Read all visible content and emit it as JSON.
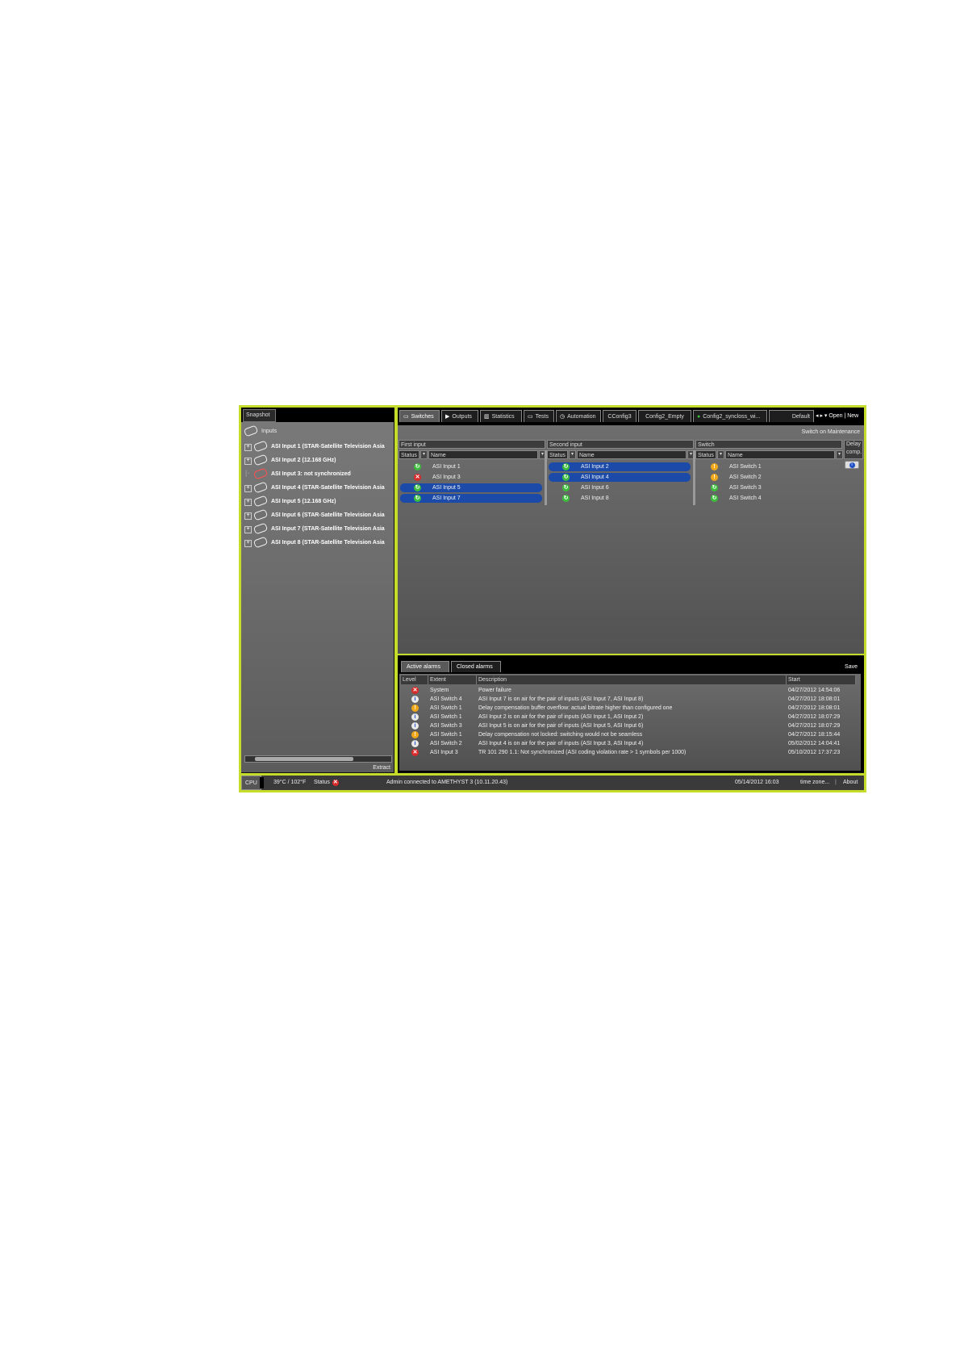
{
  "left_panel": {
    "title": "Snapshot",
    "root_label": "Inputs",
    "items": [
      {
        "label": "ASI Input 1 (STAR-Satellite Television Asia",
        "state": "ok"
      },
      {
        "label": "ASI Input 2 (12.168 GHz)",
        "state": "ok"
      },
      {
        "label": "ASI Input 3: not synchronized",
        "state": "error"
      },
      {
        "label": "ASI Input 4 (STAR-Satellite Television Asia",
        "state": "ok"
      },
      {
        "label": "ASI Input 5 (12.168 GHz)",
        "state": "ok"
      },
      {
        "label": "ASI Input 6 (STAR-Satellite Television Asia",
        "state": "ok"
      },
      {
        "label": "ASI Input 7 (STAR-Satellite Television Asia",
        "state": "ok"
      },
      {
        "label": "ASI Input 8 (STAR-Satellite Television Asia",
        "state": "ok"
      }
    ],
    "extract_label": "Extract"
  },
  "tabs": {
    "items": [
      "Switches",
      "Outputs",
      "Statistics",
      "Tests",
      "Automation",
      "CConfig3",
      "Config2_Empty",
      "Config2_syncloss_wi...",
      "Default"
    ],
    "nav": "◂ ▸ ▾  Open | New"
  },
  "switches": {
    "maintenance_label": "Switch on Maintenance",
    "groups": [
      "First input",
      "Second input",
      "Switch",
      "Delay comp."
    ],
    "status_header": "Status",
    "name_header": "Name",
    "first_input": [
      {
        "status": "ok",
        "name": "ASI Input 1",
        "selected": false
      },
      {
        "status": "err",
        "name": "ASI Input 3",
        "selected": false
      },
      {
        "status": "ok",
        "name": "ASI Input 5",
        "selected": true
      },
      {
        "status": "ok",
        "name": "ASI Input 7",
        "selected": true
      }
    ],
    "second_input": [
      {
        "status": "ok",
        "name": "ASI Input 2",
        "selected": true
      },
      {
        "status": "ok",
        "name": "ASI Input 4",
        "selected": true
      },
      {
        "status": "ok",
        "name": "ASI Input 6",
        "selected": false
      },
      {
        "status": "ok",
        "name": "ASI Input 8",
        "selected": false
      }
    ],
    "switch": [
      {
        "status": "warn",
        "name": "ASI Switch 1"
      },
      {
        "status": "warn",
        "name": "ASI Switch 2"
      },
      {
        "status": "ok",
        "name": "ASI Switch 3"
      },
      {
        "status": "ok",
        "name": "ASI Switch 4"
      }
    ]
  },
  "alarms": {
    "tabs": [
      "Active alarms",
      "Closed alarms"
    ],
    "save_label": "Save",
    "headers": [
      "Level",
      "Extent",
      "Description",
      "Start"
    ],
    "rows": [
      {
        "level": "err",
        "extent": "System",
        "description": "Power failure",
        "start": "04/27/2012 14:54:06"
      },
      {
        "level": "info",
        "extent": "ASI Switch 4",
        "description": "ASI Input 7 is on air for the pair of inputs (ASI Input 7, ASI Input 8)",
        "start": "04/27/2012 18:08:01"
      },
      {
        "level": "warn",
        "extent": "ASI Switch 1",
        "description": "Delay compensation buffer overflow: actual bitrate higher than configured one",
        "start": "04/27/2012 18:08:01"
      },
      {
        "level": "info",
        "extent": "ASI Switch 1",
        "description": "ASI Input 2 is on air for the pair of inputs (ASI Input 1, ASI Input 2)",
        "start": "04/27/2012 18:07:29"
      },
      {
        "level": "info",
        "extent": "ASI Switch 3",
        "description": "ASI Input 5 is on air for the pair of inputs (ASI Input 5, ASI Input 6)",
        "start": "04/27/2012 18:07:29"
      },
      {
        "level": "warn",
        "extent": "ASI Switch 1",
        "description": "Delay compensation not locked: switching would not be seamless",
        "start": "04/27/2012 18:15:44"
      },
      {
        "level": "info",
        "extent": "ASI Switch 2",
        "description": "ASI Input 4 is on air for the pair of inputs (ASI Input 3, ASI Input 4)",
        "start": "05/02/2012 14:04:41"
      },
      {
        "level": "err",
        "extent": "ASI Input 3",
        "description": "TR 101 290 1.1: Not synchronized (ASI coding violation rate > 1 symbols per 1000)",
        "start": "05/10/2012 17:37:23"
      }
    ]
  },
  "statusbar": {
    "cpu": "CPU",
    "temperature": "39°C / 102°F",
    "status_label": "Status",
    "connection": "Admin connected to AMETHYST 3 (10.11.20.43)",
    "datetime": "05/14/2012 16:03",
    "timezone": "time zone...",
    "about": "About"
  },
  "colors": {
    "highlight": "#c6dc2a",
    "selection": "#1b4aa8",
    "ok": "#3cbe3c",
    "error": "#d82a2a",
    "warning": "#f0a818"
  }
}
